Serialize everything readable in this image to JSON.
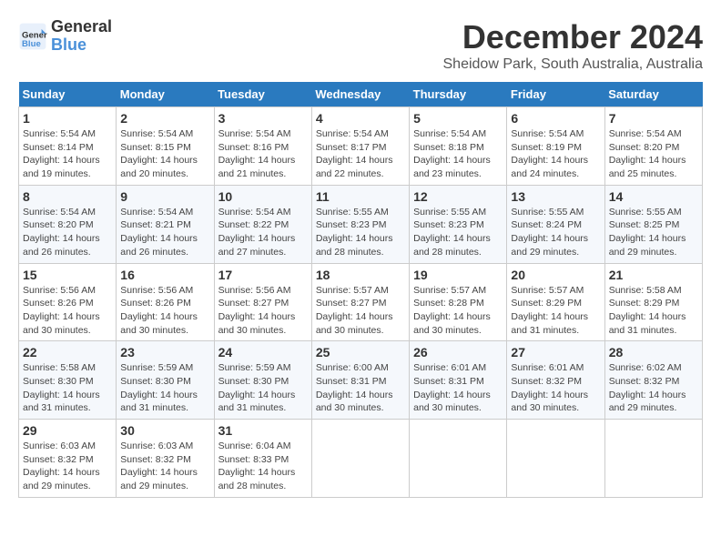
{
  "logo": {
    "text_general": "General",
    "text_blue": "Blue"
  },
  "title": "December 2024",
  "location": "Sheidow Park, South Australia, Australia",
  "days_of_week": [
    "Sunday",
    "Monday",
    "Tuesday",
    "Wednesday",
    "Thursday",
    "Friday",
    "Saturday"
  ],
  "weeks": [
    [
      {
        "day": "1",
        "info": "Sunrise: 5:54 AM\nSunset: 8:14 PM\nDaylight: 14 hours\nand 19 minutes."
      },
      {
        "day": "2",
        "info": "Sunrise: 5:54 AM\nSunset: 8:15 PM\nDaylight: 14 hours\nand 20 minutes."
      },
      {
        "day": "3",
        "info": "Sunrise: 5:54 AM\nSunset: 8:16 PM\nDaylight: 14 hours\nand 21 minutes."
      },
      {
        "day": "4",
        "info": "Sunrise: 5:54 AM\nSunset: 8:17 PM\nDaylight: 14 hours\nand 22 minutes."
      },
      {
        "day": "5",
        "info": "Sunrise: 5:54 AM\nSunset: 8:18 PM\nDaylight: 14 hours\nand 23 minutes."
      },
      {
        "day": "6",
        "info": "Sunrise: 5:54 AM\nSunset: 8:19 PM\nDaylight: 14 hours\nand 24 minutes."
      },
      {
        "day": "7",
        "info": "Sunrise: 5:54 AM\nSunset: 8:20 PM\nDaylight: 14 hours\nand 25 minutes."
      }
    ],
    [
      {
        "day": "8",
        "info": "Sunrise: 5:54 AM\nSunset: 8:20 PM\nDaylight: 14 hours\nand 26 minutes."
      },
      {
        "day": "9",
        "info": "Sunrise: 5:54 AM\nSunset: 8:21 PM\nDaylight: 14 hours\nand 26 minutes."
      },
      {
        "day": "10",
        "info": "Sunrise: 5:54 AM\nSunset: 8:22 PM\nDaylight: 14 hours\nand 27 minutes."
      },
      {
        "day": "11",
        "info": "Sunrise: 5:55 AM\nSunset: 8:23 PM\nDaylight: 14 hours\nand 28 minutes."
      },
      {
        "day": "12",
        "info": "Sunrise: 5:55 AM\nSunset: 8:23 PM\nDaylight: 14 hours\nand 28 minutes."
      },
      {
        "day": "13",
        "info": "Sunrise: 5:55 AM\nSunset: 8:24 PM\nDaylight: 14 hours\nand 29 minutes."
      },
      {
        "day": "14",
        "info": "Sunrise: 5:55 AM\nSunset: 8:25 PM\nDaylight: 14 hours\nand 29 minutes."
      }
    ],
    [
      {
        "day": "15",
        "info": "Sunrise: 5:56 AM\nSunset: 8:26 PM\nDaylight: 14 hours\nand 30 minutes."
      },
      {
        "day": "16",
        "info": "Sunrise: 5:56 AM\nSunset: 8:26 PM\nDaylight: 14 hours\nand 30 minutes."
      },
      {
        "day": "17",
        "info": "Sunrise: 5:56 AM\nSunset: 8:27 PM\nDaylight: 14 hours\nand 30 minutes."
      },
      {
        "day": "18",
        "info": "Sunrise: 5:57 AM\nSunset: 8:27 PM\nDaylight: 14 hours\nand 30 minutes."
      },
      {
        "day": "19",
        "info": "Sunrise: 5:57 AM\nSunset: 8:28 PM\nDaylight: 14 hours\nand 30 minutes."
      },
      {
        "day": "20",
        "info": "Sunrise: 5:57 AM\nSunset: 8:29 PM\nDaylight: 14 hours\nand 31 minutes."
      },
      {
        "day": "21",
        "info": "Sunrise: 5:58 AM\nSunset: 8:29 PM\nDaylight: 14 hours\nand 31 minutes."
      }
    ],
    [
      {
        "day": "22",
        "info": "Sunrise: 5:58 AM\nSunset: 8:30 PM\nDaylight: 14 hours\nand 31 minutes."
      },
      {
        "day": "23",
        "info": "Sunrise: 5:59 AM\nSunset: 8:30 PM\nDaylight: 14 hours\nand 31 minutes."
      },
      {
        "day": "24",
        "info": "Sunrise: 5:59 AM\nSunset: 8:30 PM\nDaylight: 14 hours\nand 31 minutes."
      },
      {
        "day": "25",
        "info": "Sunrise: 6:00 AM\nSunset: 8:31 PM\nDaylight: 14 hours\nand 30 minutes."
      },
      {
        "day": "26",
        "info": "Sunrise: 6:01 AM\nSunset: 8:31 PM\nDaylight: 14 hours\nand 30 minutes."
      },
      {
        "day": "27",
        "info": "Sunrise: 6:01 AM\nSunset: 8:32 PM\nDaylight: 14 hours\nand 30 minutes."
      },
      {
        "day": "28",
        "info": "Sunrise: 6:02 AM\nSunset: 8:32 PM\nDaylight: 14 hours\nand 29 minutes."
      }
    ],
    [
      {
        "day": "29",
        "info": "Sunrise: 6:03 AM\nSunset: 8:32 PM\nDaylight: 14 hours\nand 29 minutes."
      },
      {
        "day": "30",
        "info": "Sunrise: 6:03 AM\nSunset: 8:32 PM\nDaylight: 14 hours\nand 29 minutes."
      },
      {
        "day": "31",
        "info": "Sunrise: 6:04 AM\nSunset: 8:33 PM\nDaylight: 14 hours\nand 28 minutes."
      },
      {
        "day": "",
        "info": ""
      },
      {
        "day": "",
        "info": ""
      },
      {
        "day": "",
        "info": ""
      },
      {
        "day": "",
        "info": ""
      }
    ]
  ]
}
